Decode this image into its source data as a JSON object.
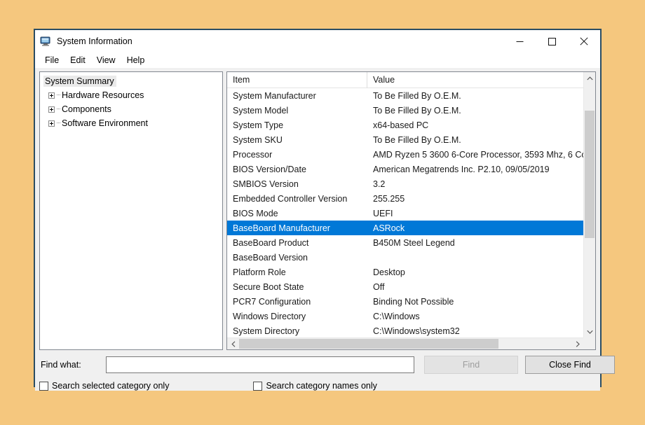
{
  "window": {
    "title": "System Information",
    "icon": "system-information-icon",
    "controls": {
      "minimize": "minimize-icon",
      "maximize": "maximize-icon",
      "close": "close-icon"
    }
  },
  "menubar": {
    "items": [
      {
        "label": "File"
      },
      {
        "label": "Edit"
      },
      {
        "label": "View"
      },
      {
        "label": "Help"
      }
    ]
  },
  "tree": {
    "root": {
      "label": "System Summary",
      "selected": true
    },
    "children": [
      {
        "label": "Hardware Resources"
      },
      {
        "label": "Components"
      },
      {
        "label": "Software Environment"
      }
    ]
  },
  "list": {
    "columns": [
      {
        "label": "Item"
      },
      {
        "label": "Value"
      }
    ],
    "rows": [
      {
        "item": "System Manufacturer",
        "value": "To Be Filled By O.E.M.",
        "selected": false
      },
      {
        "item": "System Model",
        "value": "To Be Filled By O.E.M.",
        "selected": false
      },
      {
        "item": "System Type",
        "value": "x64-based PC",
        "selected": false
      },
      {
        "item": "System SKU",
        "value": "To Be Filled By O.E.M.",
        "selected": false
      },
      {
        "item": "Processor",
        "value": "AMD Ryzen 5 3600 6-Core Processor, 3593 Mhz, 6 Co",
        "selected": false
      },
      {
        "item": "BIOS Version/Date",
        "value": "American Megatrends Inc. P2.10, 09/05/2019",
        "selected": false
      },
      {
        "item": "SMBIOS Version",
        "value": "3.2",
        "selected": false
      },
      {
        "item": "Embedded Controller Version",
        "value": "255.255",
        "selected": false
      },
      {
        "item": "BIOS Mode",
        "value": "UEFI",
        "selected": false
      },
      {
        "item": "BaseBoard Manufacturer",
        "value": "ASRock",
        "selected": true
      },
      {
        "item": "BaseBoard Product",
        "value": "B450M Steel Legend",
        "selected": false
      },
      {
        "item": "BaseBoard Version",
        "value": "",
        "selected": false
      },
      {
        "item": "Platform Role",
        "value": "Desktop",
        "selected": false
      },
      {
        "item": "Secure Boot State",
        "value": "Off",
        "selected": false
      },
      {
        "item": "PCR7 Configuration",
        "value": "Binding Not Possible",
        "selected": false
      },
      {
        "item": "Windows Directory",
        "value": "C:\\Windows",
        "selected": false
      },
      {
        "item": "System Directory",
        "value": "C:\\Windows\\system32",
        "selected": false
      }
    ],
    "selection_color": "#0078d7"
  },
  "findbar": {
    "label": "Find what:",
    "input_value": "",
    "input_placeholder": "",
    "find_button": "Find",
    "close_find_button": "Close Find",
    "checkbox_selected_category": "Search selected category only",
    "checkbox_category_names": "Search category names only",
    "checkbox_selected_category_checked": false,
    "checkbox_category_names_checked": false
  },
  "theme": {
    "desktop_background": "#f5c77e",
    "window_border": "#2b4d63",
    "accent": "#0078d7"
  }
}
